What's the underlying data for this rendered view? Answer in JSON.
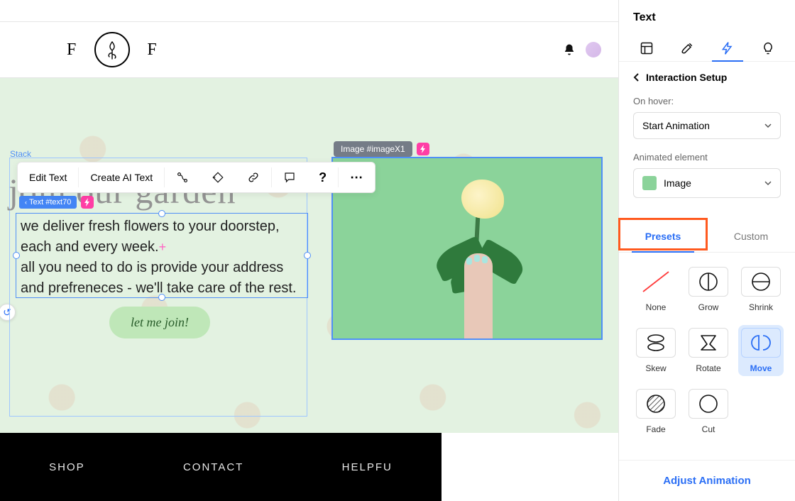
{
  "logo": {
    "left": "F",
    "right": "F"
  },
  "canvas": {
    "stack_label": "Stack",
    "headline": "join our garden",
    "toolbar": {
      "edit_text": "Edit Text",
      "create_ai_text": "Create AI Text"
    },
    "text_chip": "Text #text70",
    "body_line1": "we deliver fresh flowers to your doorstep,",
    "body_line2": "each and every week.",
    "body_line3": "all you need to do is provide your address",
    "body_line4": "and prefreneces - we'll take care of the rest.",
    "cta": "let me join!",
    "image_chip": "Image #imageX1"
  },
  "footer": {
    "col1": "SHOP",
    "col2": "CONTACT",
    "col3": "HELPFU"
  },
  "panel": {
    "title": "Text",
    "back_label": "Interaction Setup",
    "hover_label": "On hover:",
    "hover_value": "Start Animation",
    "animated_label": "Animated element",
    "animated_value": "Image",
    "tabs": {
      "presets": "Presets",
      "custom": "Custom"
    },
    "presets": {
      "none": "None",
      "grow": "Grow",
      "shrink": "Shrink",
      "skew": "Skew",
      "rotate": "Rotate",
      "move": "Move",
      "fade": "Fade",
      "cut": "Cut"
    },
    "adjust": "Adjust Animation"
  }
}
